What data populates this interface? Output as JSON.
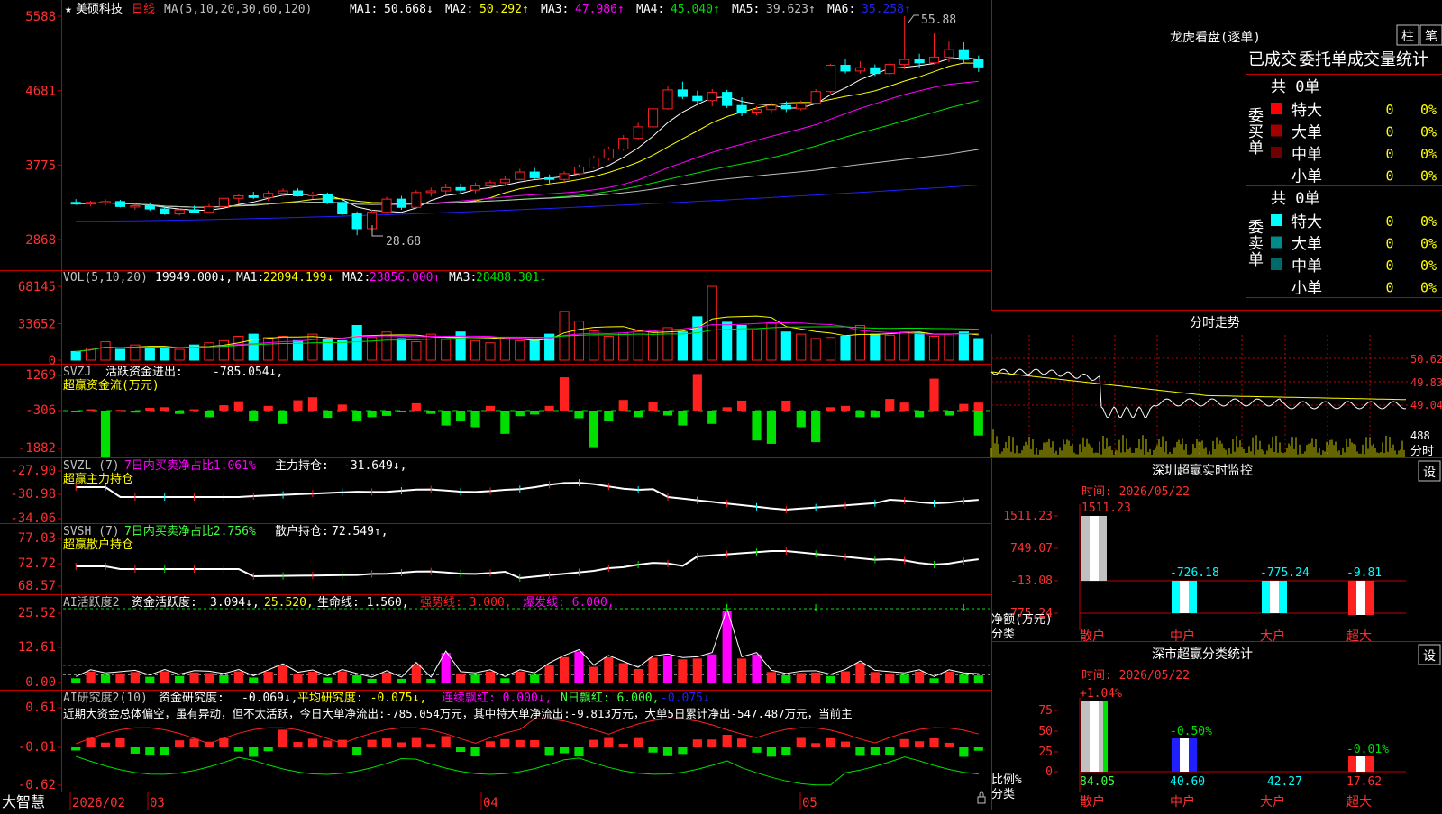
{
  "colors": {
    "bg": "#000000",
    "frame": "#c00000",
    "up": "#ff2020",
    "down": "#00ffff",
    "green": "#00e000",
    "white": "#ffffff",
    "yellow": "#ffff00",
    "magenta": "#ff00ff",
    "blue": "#2020ff",
    "gray": "#c0c0c0",
    "axis_red": "#ff3030",
    "light_green": "#40ff40"
  },
  "main_panel": {
    "star": "★",
    "name": "美硕科技",
    "period": "日线",
    "ma_params": "MA(5,10,20,30,60,120)",
    "ma_values": [
      {
        "label": "MA1:",
        "value": "50.668↓",
        "color": "#ffffff"
      },
      {
        "label": "MA2:",
        "value": "50.292↑",
        "color": "#ffff00"
      },
      {
        "label": "MA3:",
        "value": "47.986↑",
        "color": "#ff00ff"
      },
      {
        "label": "MA4:",
        "value": "45.040↑",
        "color": "#00e000"
      },
      {
        "label": "MA5:",
        "value": "39.623↑",
        "color": "#c0c0c0"
      },
      {
        "label": "MA6:",
        "value": "35.258↑",
        "color": "#2020ff"
      }
    ],
    "y_ticks": [
      "55.88",
      "46.81",
      "37.75",
      "28.68"
    ],
    "high_label": "55.88",
    "low_label": "28.68"
  },
  "chart_data": [
    {
      "type": "candlestick",
      "title": "美硕科技 日线",
      "price_range": [
        28.68,
        55.88
      ],
      "ohlc": [
        [
          33.2,
          33.6,
          32.9,
          33.0
        ],
        [
          33.0,
          33.4,
          32.7,
          33.2
        ],
        [
          33.2,
          33.6,
          32.8,
          33.3
        ],
        [
          33.3,
          33.5,
          32.6,
          32.7
        ],
        [
          32.7,
          33.0,
          32.3,
          32.8
        ],
        [
          32.8,
          33.2,
          32.2,
          32.4
        ],
        [
          32.4,
          32.7,
          31.7,
          31.8
        ],
        [
          31.8,
          32.5,
          31.6,
          32.3
        ],
        [
          32.3,
          32.8,
          31.9,
          32.0
        ],
        [
          32.0,
          33.0,
          31.9,
          32.7
        ],
        [
          32.7,
          34.0,
          32.5,
          33.7
        ],
        [
          33.7,
          34.2,
          33.0,
          34.0
        ],
        [
          34.0,
          34.5,
          33.6,
          33.8
        ],
        [
          33.8,
          34.6,
          33.4,
          34.3
        ],
        [
          34.3,
          34.9,
          33.9,
          34.6
        ],
        [
          34.6,
          34.9,
          33.9,
          34.0
        ],
        [
          34.0,
          34.5,
          33.6,
          34.2
        ],
        [
          34.2,
          34.4,
          33.0,
          33.2
        ],
        [
          33.2,
          33.6,
          31.6,
          31.8
        ],
        [
          31.8,
          32.1,
          29.2,
          30.0
        ],
        [
          30.0,
          32.3,
          29.8,
          32.0
        ],
        [
          32.0,
          33.9,
          31.8,
          33.6
        ],
        [
          33.6,
          34.0,
          32.3,
          32.6
        ],
        [
          32.6,
          34.7,
          32.5,
          34.4
        ],
        [
          34.4,
          35.0,
          33.9,
          34.6
        ],
        [
          34.6,
          35.5,
          34.1,
          35.0
        ],
        [
          35.0,
          35.5,
          34.2,
          34.7
        ],
        [
          34.7,
          35.6,
          34.3,
          35.2
        ],
        [
          35.2,
          35.9,
          34.8,
          35.6
        ],
        [
          35.6,
          36.4,
          35.2,
          36.0
        ],
        [
          36.0,
          37.3,
          35.9,
          36.9
        ],
        [
          36.9,
          37.4,
          36.0,
          36.2
        ],
        [
          36.2,
          36.6,
          35.5,
          36.0
        ],
        [
          36.0,
          37.0,
          35.8,
          36.7
        ],
        [
          36.7,
          37.8,
          36.5,
          37.5
        ],
        [
          37.5,
          38.9,
          37.3,
          38.6
        ],
        [
          38.6,
          40.0,
          38.3,
          39.7
        ],
        [
          39.7,
          41.4,
          39.5,
          41.0
        ],
        [
          41.0,
          42.9,
          40.8,
          42.4
        ],
        [
          42.4,
          45.1,
          42.2,
          44.6
        ],
        [
          44.6,
          47.4,
          44.5,
          46.9
        ],
        [
          46.9,
          47.9,
          45.8,
          46.1
        ],
        [
          46.1,
          46.8,
          45.2,
          45.6
        ],
        [
          45.6,
          47.0,
          44.9,
          46.6
        ],
        [
          46.6,
          46.9,
          44.7,
          45.0
        ],
        [
          45.0,
          46.0,
          43.7,
          44.2
        ],
        [
          44.2,
          44.9,
          43.8,
          44.5
        ],
        [
          44.5,
          45.4,
          44.0,
          45.0
        ],
        [
          45.0,
          45.5,
          44.2,
          44.6
        ],
        [
          44.6,
          45.6,
          44.4,
          45.3
        ],
        [
          45.3,
          47.0,
          45.1,
          46.7
        ],
        [
          46.7,
          50.1,
          46.5,
          49.9
        ],
        [
          49.9,
          50.7,
          48.9,
          49.2
        ],
        [
          49.2,
          50.4,
          48.9,
          49.6
        ],
        [
          49.6,
          50.0,
          48.6,
          48.9
        ],
        [
          48.9,
          50.3,
          48.4,
          50.0
        ],
        [
          50.0,
          55.88,
          49.4,
          50.6
        ],
        [
          50.6,
          51.3,
          49.6,
          50.2
        ],
        [
          50.2,
          53.8,
          50.0,
          50.9
        ],
        [
          50.9,
          52.8,
          50.3,
          51.8
        ],
        [
          51.8,
          52.7,
          50.1,
          50.6
        ],
        [
          50.6,
          51.1,
          49.1,
          49.7
        ]
      ],
      "ma_levels": {
        "MA1": 50.668,
        "MA2": 50.292,
        "MA3": 47.986,
        "MA4": 45.04,
        "MA5": 39.623,
        "MA6": 35.258
      }
    },
    {
      "type": "bar",
      "title": "VOL(5,10,20)",
      "values": [
        8000,
        11000,
        17000,
        10000,
        14000,
        12000,
        11000,
        10000,
        14000,
        16000,
        18000,
        22000,
        24000,
        21000,
        22000,
        18000,
        24000,
        19000,
        18000,
        32000,
        21000,
        26000,
        20000,
        17000,
        24000,
        19000,
        26000,
        18000,
        16000,
        20000,
        18000,
        19000,
        24000,
        45000,
        36000,
        27000,
        22000,
        25000,
        27000,
        26000,
        30000,
        26000,
        40000,
        68145,
        35000,
        32000,
        28000,
        34000,
        26000,
        24000,
        20000,
        21000,
        22000,
        32000,
        24000,
        23000,
        26000,
        25000,
        22000,
        24000,
        26000,
        19949
      ],
      "ticks": [
        "68145",
        "33652",
        "0"
      ]
    },
    {
      "type": "bar",
      "title": "SVZJ 活跃资金进出",
      "values": [
        -20,
        40,
        -1400,
        20,
        -60,
        80,
        100,
        -100,
        40,
        -200,
        160,
        280,
        -300,
        140,
        -400,
        310,
        400,
        -220,
        180,
        -300,
        -200,
        -160,
        -40,
        220,
        -100,
        -450,
        -300,
        -500,
        140,
        -700,
        -170,
        -120,
        140,
        1000,
        -230,
        -1100,
        -300,
        320,
        -200,
        250,
        -150,
        -450,
        1100,
        -400,
        100,
        300,
        -900,
        -1000,
        300,
        -500,
        -950,
        100,
        140,
        -200,
        -200,
        350,
        240,
        -200,
        960,
        -150,
        200,
        240,
        200,
        -750
      ],
      "ticks": [
        "1269",
        "-306",
        "-1882"
      ]
    },
    {
      "type": "line",
      "title": "SVZL 主力持仓",
      "ticks": [
        "-27.90",
        "-30.98",
        "-34.06"
      ]
    },
    {
      "type": "line",
      "title": "SVSH 散户持仓",
      "ticks": [
        "77.03",
        "72.72",
        "68.57"
      ]
    },
    {
      "type": "bar",
      "title": "AI活跃度2 资金活跃度",
      "ticks": [
        "25.52",
        "12.61",
        "0.00"
      ]
    },
    {
      "type": "bar",
      "title": "AI研究度2(10) 资金研究度",
      "ticks": [
        "0.61",
        "-0.01",
        "-0.62"
      ]
    }
  ],
  "vol_panel": {
    "header": "VOL(5,10,20)",
    "current": "19949.000↓,",
    "ma": [
      {
        "label": "MA1:",
        "value": "22094.199↓",
        "color": "#ffff00"
      },
      {
        "label": "MA2:",
        "value": "23856.000↑",
        "color": "#ff00ff"
      },
      {
        "label": "MA3:",
        "value": "28488.301↓",
        "color": "#00e000"
      }
    ]
  },
  "svzj_panel": {
    "header": "SVZJ",
    "label": "活跃资金进出:",
    "value": "-785.054↓,",
    "sub": "超赢资金流(万元)"
  },
  "svzl_panel": {
    "header": "SVZL (7)",
    "ratio": "7日内买卖净占比1.061%",
    "label": "主力持仓:",
    "value": "-31.649↓,",
    "sub": "超赢主力持仓"
  },
  "svsh_panel": {
    "header": "SVSH (7)",
    "ratio": "7日内买卖净占比2.756%",
    "label": "散户持仓:",
    "value": "72.549↑,",
    "sub": "超赢散户持仓"
  },
  "ai_panel": {
    "header": "AI活跃度2",
    "label": "资金活跃度:",
    "value": "3.094↓,",
    "v2": "25.520,",
    "life": "生命线: 1.560,",
    "strong": "强势线: 3.000,",
    "burst": "爆发线: 6.000,"
  },
  "ai2_panel": {
    "header": "AI研究度2(10)",
    "label": "资金研究度:",
    "value": "-0.069↓,",
    "avg": "平均研究度: -0.075↓,",
    "cont": "连续飘红: 0.000↓,",
    "nday": "N日飘红: 6.000,",
    "last": "-0.075↓",
    "note": "近期大资金总体偏空，虽有异动，但不太活跃，今日大单净流出:-785.054万元，其中特大单净流出:-9.813万元，大单5日累计净出-547.487万元，当前主"
  },
  "time_axis": {
    "brand": "大智慧",
    "labels": [
      "2026/02",
      "03",
      "04",
      "05"
    ]
  },
  "right": {
    "lhb_title": "龙虎看盘(逐单)",
    "btn_bar": "柱",
    "btn_pen": "笔",
    "tabs": [
      "已成交",
      "委托单",
      "成交量",
      "统计"
    ],
    "buy": {
      "side": "委买单",
      "total": "共 0单",
      "rows": [
        {
          "name": "特大",
          "n": "0",
          "p": "0%",
          "color": "#ff0000"
        },
        {
          "name": "大单",
          "n": "0",
          "p": "0%",
          "color": "#a00000"
        },
        {
          "name": "中单",
          "n": "0",
          "p": "0%",
          "color": "#700000"
        },
        {
          "name": "小单",
          "n": "0",
          "p": "0%",
          "color": "#000000"
        }
      ]
    },
    "sell": {
      "side": "委卖单",
      "total": "共 0单",
      "rows": [
        {
          "name": "特大",
          "n": "0",
          "p": "0%",
          "color": "#00ffff"
        },
        {
          "name": "大单",
          "n": "0",
          "p": "0%",
          "color": "#008a8a"
        },
        {
          "name": "中单",
          "n": "0",
          "p": "0%",
          "color": "#006a6a"
        },
        {
          "name": "小单",
          "n": "0",
          "p": "0%",
          "color": "#000000"
        }
      ]
    },
    "intraday": {
      "title": "分时走势",
      "prices": [
        "50.62",
        "49.83",
        "49.04"
      ],
      "vol_label": "488",
      "vol_unit": "分时"
    },
    "monitor": {
      "title": "深圳超赢实时监控",
      "setting": "设",
      "time": "时间: 2026/05/22",
      "ticks": [
        "1511.23",
        "749.07",
        "-13.08",
        "-775.24"
      ],
      "unit1": "净额(万元)",
      "unit2": "分类",
      "cats": [
        "散户",
        "中户",
        "大户",
        "超大"
      ],
      "values": [
        "1511.23",
        "-726.18",
        "-775.24",
        "-9.81"
      ]
    },
    "stats": {
      "title": "深市超赢分类统计",
      "setting": "设",
      "time": "时间: 2026/05/22",
      "ticks": [
        "75",
        "50",
        "25",
        "0"
      ],
      "unit1": "比例%",
      "unit2": "分类",
      "cats": [
        "散户",
        "中户",
        "大户",
        "超大"
      ],
      "top": [
        "+1.04%",
        "-0.50%",
        "",
        "-0.01%"
      ],
      "bottom": [
        "84.05",
        "40.60",
        "-42.27",
        "17.62"
      ]
    }
  }
}
